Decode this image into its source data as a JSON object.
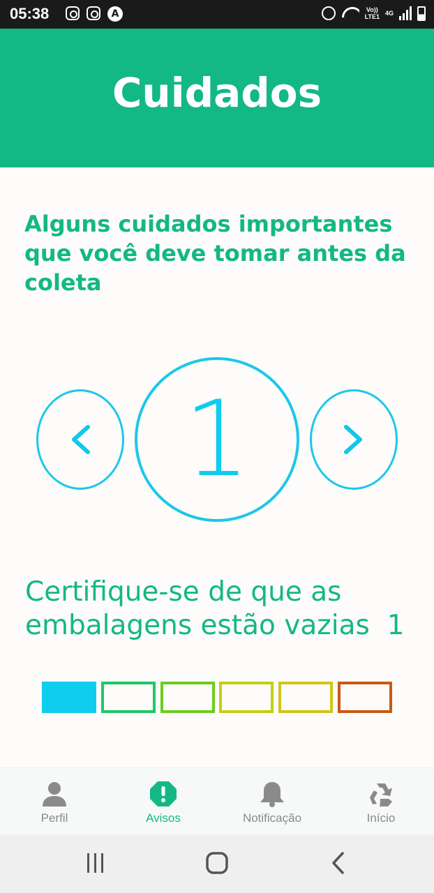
{
  "status_bar": {
    "time": "05:38",
    "a_glyph": "A",
    "network_top": "Vo))",
    "network_bottom": "LTE1",
    "net_type": "4G",
    "icons": [
      "instagram-icon",
      "instagram-icon",
      "a-icon",
      "alarm-icon",
      "wifi-icon",
      "signal-icon",
      "battery-icon"
    ]
  },
  "header": {
    "title": "Cuidados"
  },
  "subtitle": "Alguns cuidados importantes que você deve tomar antes da coleta",
  "carousel": {
    "prev_label": "‹",
    "next_label": "›",
    "current_number": "1"
  },
  "tip": {
    "text": "Certifique-se de que as embalagens estão vazias",
    "index": "1"
  },
  "progress": {
    "current": 1,
    "total": 6,
    "colors": [
      "#0fcdee",
      "#1ec865",
      "#6ccd1c",
      "#c4cf14",
      "#d2c518",
      "#c95a14"
    ]
  },
  "bottom_nav": {
    "tabs": [
      {
        "label": "Perfil",
        "icon": "person-icon",
        "active": false
      },
      {
        "label": "Avisos",
        "icon": "alert-icon",
        "active": true
      },
      {
        "label": "Notificação",
        "icon": "bell-icon",
        "active": false
      },
      {
        "label": "Início",
        "icon": "recycle-icon",
        "active": false
      }
    ]
  },
  "colors": {
    "primary": "#13b884",
    "accent": "#1cc7ea",
    "inactive": "#8a8a8a"
  }
}
